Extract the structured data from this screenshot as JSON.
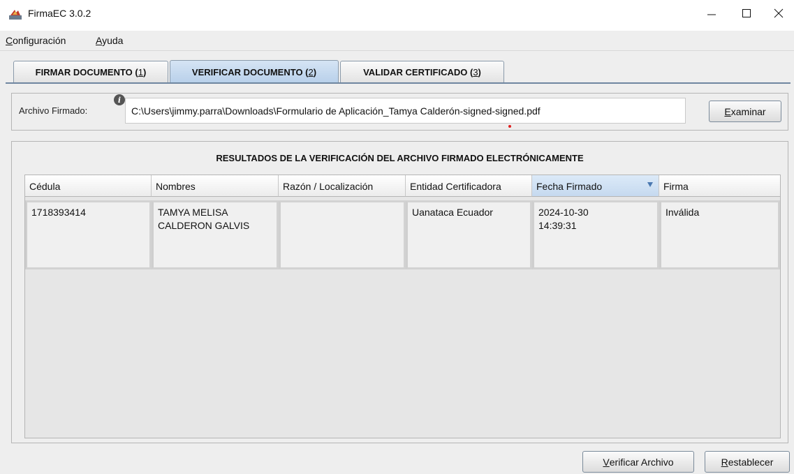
{
  "window": {
    "title": "FirmaEC 3.0.2"
  },
  "menu": {
    "items": [
      {
        "mnemonic": "C",
        "rest": "onfiguración"
      },
      {
        "mnemonic": "A",
        "rest": "yuda"
      }
    ]
  },
  "tabs": [
    {
      "label": "FIRMAR DOCUMENTO",
      "mnemonic": "1",
      "active": false
    },
    {
      "label": "VERIFICAR DOCUMENTO",
      "mnemonic": "2",
      "active": true
    },
    {
      "label": "VALIDAR CERTIFICADO",
      "mnemonic": "3",
      "active": false
    }
  ],
  "file": {
    "label": "Archivo Firmado:",
    "path": "C:\\Users\\jimmy.parra\\Downloads\\Formulario de Aplicación_Tamya Calderón-signed-signed.pdf",
    "browse_mnemonic": "E",
    "browse_rest": "xaminar"
  },
  "results": {
    "title": "RESULTADOS DE LA VERIFICACIÓN DEL ARCHIVO FIRMADO ELECTRÓNICAMENTE",
    "columns": [
      "Cédula",
      "Nombres",
      "Razón / Localización",
      "Entidad Certificadora",
      "Fecha Firmado",
      "Firma"
    ],
    "sorted_column": "Fecha Firmado",
    "rows": [
      {
        "cedula": "1718393414",
        "nombres": "TAMYA MELISA CALDERON GALVIS",
        "razon": "",
        "entidad": "Uanataca Ecuador",
        "fecha": "2024-10-30 14:39:31",
        "firma": "Inválida"
      }
    ]
  },
  "actions": {
    "verify_mnemonic": "V",
    "verify_rest": "erificar Archivo",
    "reset_mnemonic": "R",
    "reset_rest": "establecer"
  },
  "colors": {
    "accent": "#b8d0ea",
    "tab_rule": "#6f86a0",
    "sort_arrow": "#4a78b0"
  }
}
